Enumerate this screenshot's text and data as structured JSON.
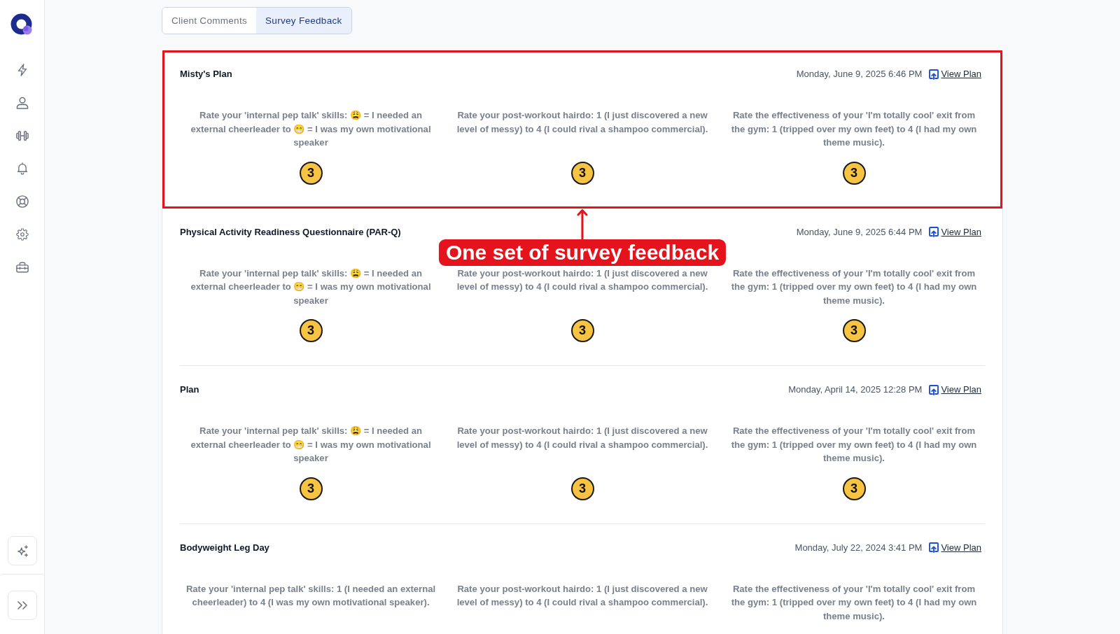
{
  "tabs": [
    {
      "label": "Client Comments",
      "selected": false
    },
    {
      "label": "Survey Feedback",
      "selected": true
    }
  ],
  "annotation": {
    "label": "One set of survey feedback"
  },
  "feedback": [
    {
      "title": "Misty's Plan",
      "date": "Monday, June 9, 2025 6:46 PM",
      "link": "View Plan",
      "highlighted": true,
      "responses": [
        {
          "question": "Rate your 'internal pep talk' skills: 😩 = I needed an external cheerleader to 😁 = I was my own motivational speaker",
          "answer": "3"
        },
        {
          "question": "Rate your post-workout hairdo: 1 (I just discovered a new level of messy) to 4 (I could rival a shampoo commercial).",
          "answer": "3"
        },
        {
          "question": "Rate the effectiveness of your 'I'm totally cool' exit from the gym: 1 (tripped over my own feet) to 4 (I had my own theme music).",
          "answer": "3"
        }
      ]
    },
    {
      "title": "Physical Activity Readiness Questionnaire (PAR-Q)",
      "date": "Monday, June 9, 2025 6:44 PM",
      "link": "View Plan",
      "highlighted": false,
      "responses": [
        {
          "question": "Rate your 'internal pep talk' skills: 😩 = I needed an external cheerleader to 😁 = I was my own motivational speaker",
          "answer": "3"
        },
        {
          "question": "Rate your post-workout hairdo: 1 (I just discovered a new level of messy) to 4 (I could rival a shampoo commercial).",
          "answer": "3"
        },
        {
          "question": "Rate the effectiveness of your 'I'm totally cool' exit from the gym: 1 (tripped over my own feet) to 4 (I had my own theme music).",
          "answer": "3"
        }
      ]
    },
    {
      "title": "Plan",
      "date": "Monday, April 14, 2025 12:28 PM",
      "link": "View Plan",
      "highlighted": false,
      "responses": [
        {
          "question": "Rate your 'internal pep talk' skills: 😩 = I needed an external cheerleader to 😁 = I was my own motivational speaker",
          "answer": "3"
        },
        {
          "question": "Rate your post-workout hairdo: 1 (I just discovered a new level of messy) to 4 (I could rival a shampoo commercial).",
          "answer": "3"
        },
        {
          "question": "Rate the effectiveness of your 'I'm totally cool' exit from the gym: 1 (tripped over my own feet) to 4 (I had my own theme music).",
          "answer": "3"
        }
      ]
    },
    {
      "title": "Bodyweight Leg Day",
      "date": "Monday, July 22, 2024 3:41 PM",
      "link": "View Plan",
      "highlighted": false,
      "responses": [
        {
          "question": "Rate your 'internal pep talk' skills: 1 (I needed an external cheerleader) to 4 (I was my own motivational speaker)."
        },
        {
          "question": "Rate your post-workout hairdo: 1 (I just discovered a new level of messy) to 4 (I could rival a shampoo commercial)."
        },
        {
          "question": "Rate the effectiveness of your 'I'm totally cool' exit from the gym: 1 (tripped over my own feet) to 4 (I had my own theme music)."
        }
      ]
    }
  ]
}
